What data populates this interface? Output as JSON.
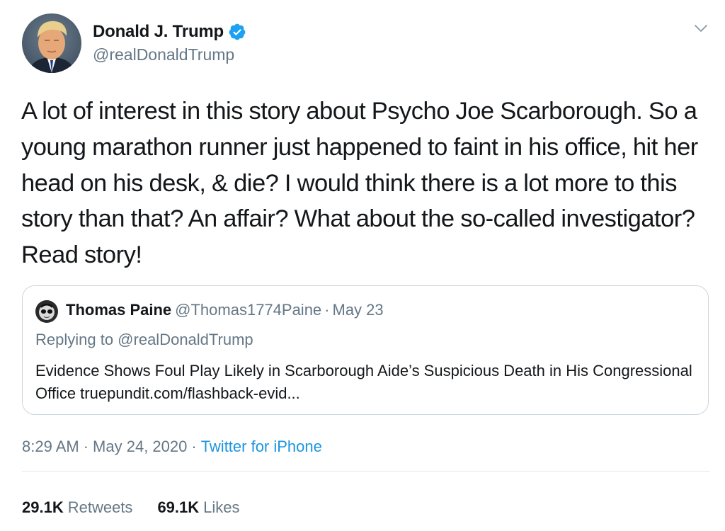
{
  "author": {
    "name": "Donald J. Trump",
    "handle": "@realDonaldTrump",
    "avatar_icon": "profile-photo",
    "verified_icon": "verified-badge-icon"
  },
  "tweet": {
    "text": "A lot of interest in this story about Psycho Joe Scarborough. So a young marathon runner just happened to faint in his office, hit her head on his desk, & die? I would think there is a lot more to this story than that? An affair? What about the so-called investigator? Read story!"
  },
  "quote": {
    "name": "Thomas Paine",
    "handle": "@Thomas1774Paine",
    "separator": "·",
    "date": "May 23",
    "replying": "Replying to @realDonaldTrump",
    "text": "Evidence Shows Foul Play Likely in Scarborough Aide’s Suspicious Death in His Congressional Office truepundit.com/flashback-evid..."
  },
  "meta": {
    "time": "8:29 AM",
    "date": "May 24, 2020",
    "separator": "·",
    "source": "Twitter for iPhone"
  },
  "stats": {
    "retweets_count": "29.1K",
    "retweets_label": "Retweets",
    "likes_count": "69.1K",
    "likes_label": "Likes"
  },
  "colors": {
    "text_primary": "#14171a",
    "text_secondary": "#657786",
    "link": "#1b95e0",
    "verified": "#1da1f2",
    "border": "#ccd6dd"
  }
}
